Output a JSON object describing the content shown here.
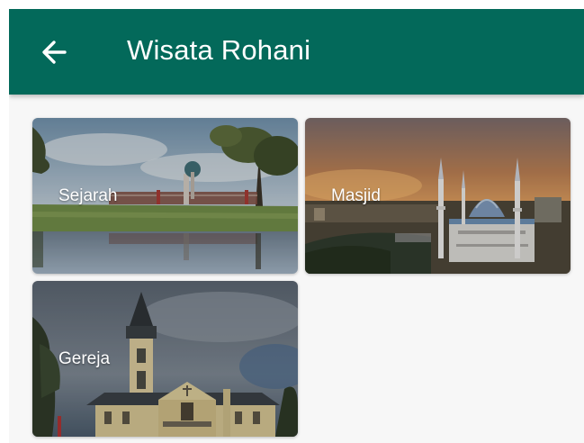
{
  "app_bar": {
    "title": "Wisata Rohani",
    "back_icon": "arrow-back-icon",
    "background_color": "#03695a"
  },
  "categories": [
    {
      "label": "Sejarah",
      "image": "monument-by-lake-photo"
    },
    {
      "label": "Masjid",
      "image": "mosque-at-sunset-photo"
    },
    {
      "label": "Gereja",
      "image": "church-with-spire-photo"
    }
  ]
}
